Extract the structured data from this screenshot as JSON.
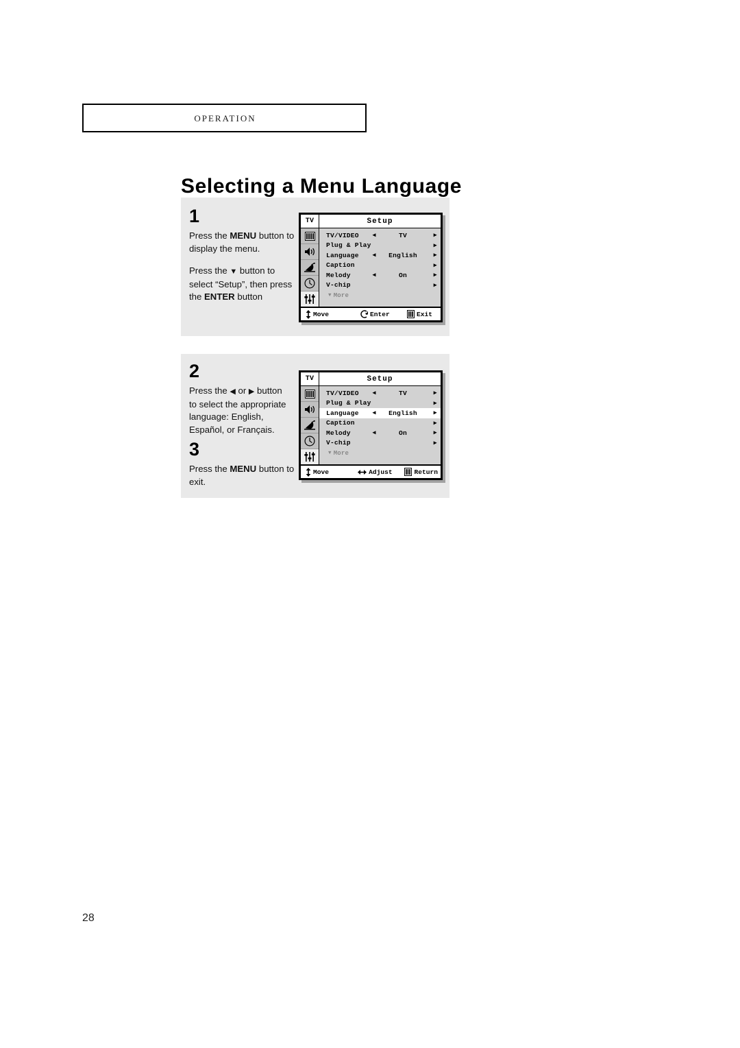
{
  "running_head": {
    "label": "Operation"
  },
  "page_title": "Selecting a Menu Language",
  "folio": "28",
  "steps": [
    {
      "number": "1",
      "lines": [
        {
          "segments": [
            {
              "text": "Press the ",
              "bold": false
            },
            {
              "text": "MENU",
              "bold": true
            },
            {
              "text": "  button to",
              "bold": false
            }
          ]
        },
        {
          "segments": [
            {
              "text": "display the menu.",
              "bold": false
            }
          ]
        },
        {
          "gap": true,
          "segments": [
            {
              "text": "Press the ",
              "bold": false
            },
            {
              "text": "▼",
              "bold": false,
              "glyph": true
            },
            {
              "text": " button to",
              "bold": false
            }
          ]
        },
        {
          "segments": [
            {
              "text": "select “Setup”, then press",
              "bold": false
            }
          ]
        },
        {
          "segments": [
            {
              "text": "the ",
              "bold": false
            },
            {
              "text": "ENTER",
              "bold": true
            },
            {
              "text": " button",
              "bold": false
            }
          ]
        }
      ]
    },
    {
      "number": "2",
      "lines": [
        {
          "segments": [
            {
              "text": "Press the ",
              "bold": false
            },
            {
              "text": "◀",
              "bold": false,
              "glyph": true
            },
            {
              "text": " or ",
              "bold": false
            },
            {
              "text": "▶",
              "bold": false,
              "glyph": true
            },
            {
              "text": " button",
              "bold": false
            }
          ]
        },
        {
          "segments": [
            {
              "text": "to select the appropriate",
              "bold": false
            }
          ]
        },
        {
          "segments": [
            {
              "text": "language: English,",
              "bold": false
            }
          ]
        },
        {
          "segments": [
            {
              "text": "Español, or Français.",
              "bold": false
            }
          ]
        }
      ]
    },
    {
      "number": "3",
      "lines": [
        {
          "segments": [
            {
              "text": "Press the ",
              "bold": false
            },
            {
              "text": "MENU",
              "bold": true
            },
            {
              "text": " button to",
              "bold": false
            }
          ]
        },
        {
          "segments": [
            {
              "text": "exit.",
              "bold": false
            }
          ]
        }
      ]
    }
  ],
  "osd": {
    "tv_tag": "TV",
    "title": "Setup",
    "sidebar_icons": [
      {
        "name": "picture-icon",
        "label": "Picture"
      },
      {
        "name": "sound-speaker-icon",
        "label": "Sound"
      },
      {
        "name": "satellite-dish-icon",
        "label": "Channel"
      },
      {
        "name": "clock-icon",
        "label": "Time"
      },
      {
        "name": "sliders-setup-icon",
        "label": "Setup",
        "active": true
      }
    ],
    "rows": [
      {
        "label": "TV/VIDEO",
        "left_arrow": "◀",
        "value": "TV",
        "right_arrow": "▶"
      },
      {
        "label": "Plug & Play",
        "left_arrow": "",
        "value": "",
        "right_arrow": "▶"
      },
      {
        "label": "Language",
        "left_arrow": "◀",
        "value": "English",
        "right_arrow": "▶"
      },
      {
        "label": "Caption",
        "left_arrow": "",
        "value": "",
        "right_arrow": "▶"
      },
      {
        "label": "Melody",
        "left_arrow": "◀",
        "value": "On",
        "right_arrow": "▶"
      },
      {
        "label": "V-chip",
        "left_arrow": "",
        "value": "",
        "right_arrow": "▶"
      }
    ],
    "more_row": {
      "caret": "▼",
      "label": "More"
    },
    "footer_step1": [
      {
        "icon": "updown-arrows-icon",
        "label": "Move"
      },
      {
        "icon": "enter-return-icon",
        "label": "Enter"
      },
      {
        "icon": "menu-bars-icon",
        "label": "Exit"
      }
    ],
    "footer_step2": [
      {
        "icon": "updown-arrows-icon",
        "label": "Move"
      },
      {
        "icon": "leftright-arrows-icon",
        "label": "Adjust"
      },
      {
        "icon": "menu-bars-icon",
        "label": "Return"
      }
    ],
    "selected_row_step1": -1,
    "selected_row_step2": 2
  }
}
